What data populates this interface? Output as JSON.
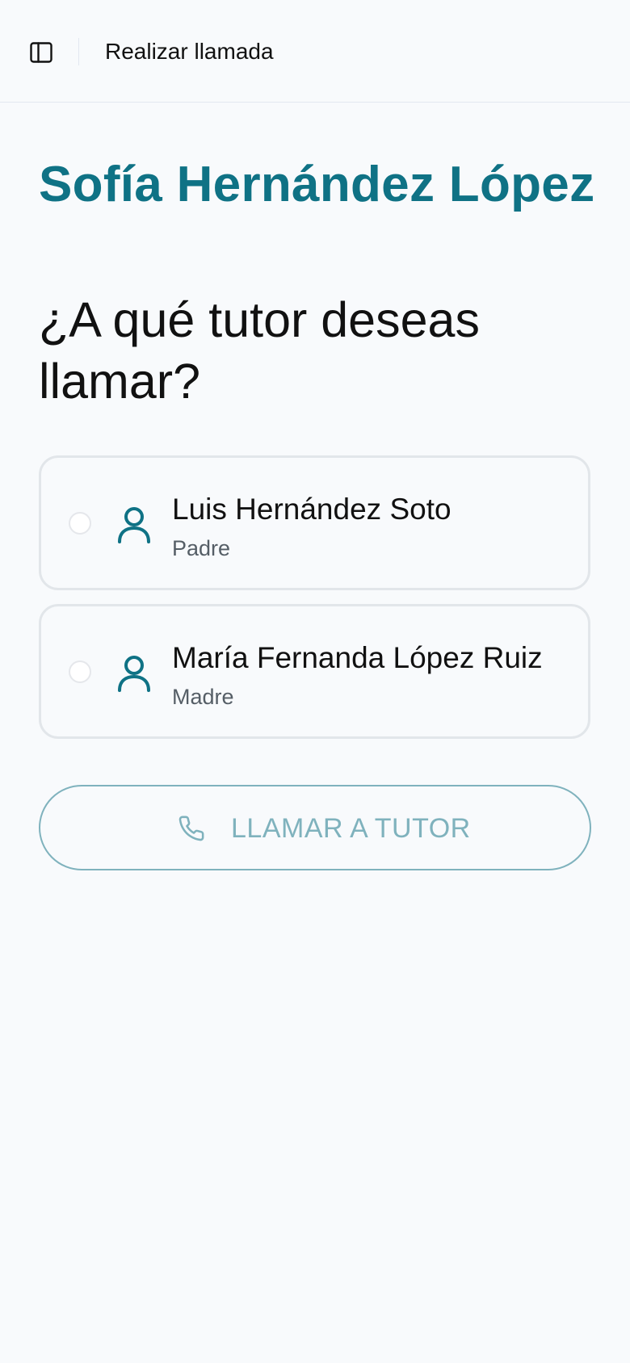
{
  "header": {
    "title": "Realizar llamada",
    "sidebar_toggle_icon": "panel-left-icon"
  },
  "student": {
    "name": "Sofía Hernández López"
  },
  "question": "¿A qué tutor deseas llamar?",
  "tutors": [
    {
      "name": "Luis Hernández Soto",
      "relation": "Padre",
      "icon": "user-icon",
      "selected": false
    },
    {
      "name": "María Fernanda López Ruiz",
      "relation": "Madre",
      "icon": "user-icon",
      "selected": false
    }
  ],
  "call_button": {
    "label": "LLAMAR A TUTOR",
    "icon": "phone-icon",
    "enabled": false
  },
  "colors": {
    "accent": "#0f7285",
    "background": "#f8fafc",
    "disabled_button": "#7fb2bd",
    "border": "#e2e6ea"
  }
}
